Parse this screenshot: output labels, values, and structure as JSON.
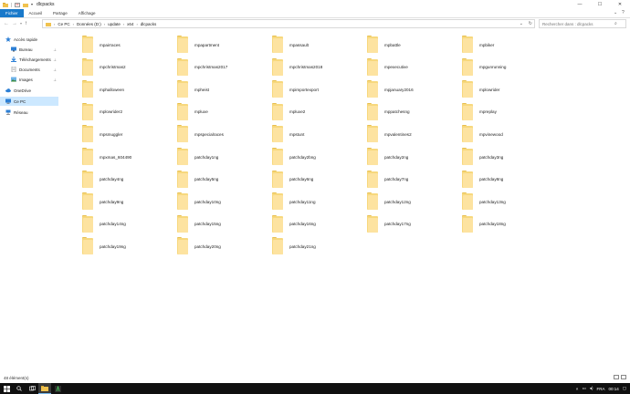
{
  "window": {
    "title": "dlcpacks",
    "minimize_glyph": "—",
    "maximize_glyph": "☐",
    "close_glyph": "✕"
  },
  "ribbon": {
    "tabs": [
      "Fichier",
      "Accueil",
      "Partage",
      "Affichage"
    ]
  },
  "address": {
    "crumbs": [
      "Ce PC",
      "Données (D:)",
      "update",
      "x64",
      "dlcpacks"
    ],
    "search_placeholder": "Rechercher dans : dlcpacks"
  },
  "sidebar": {
    "items": [
      {
        "label": "Accès rapide",
        "icon": "star-icon"
      },
      {
        "label": "Bureau",
        "icon": "desktop-icon",
        "pinned": true
      },
      {
        "label": "Téléchargements",
        "icon": "download-icon",
        "pinned": true
      },
      {
        "label": "Documents",
        "icon": "documents-icon",
        "pinned": true
      },
      {
        "label": "Images",
        "icon": "pictures-icon",
        "pinned": true
      },
      {
        "label": "OneDrive",
        "icon": "cloud-icon"
      },
      {
        "label": "Ce PC",
        "icon": "computer-icon",
        "selected": true
      },
      {
        "label": "Réseau",
        "icon": "network-icon"
      }
    ],
    "pin_glyph": "⊥"
  },
  "folders": [
    "mpairraces",
    "mpapartment",
    "mpassault",
    "mpbattle",
    "mpbiker",
    "mpchristmas2",
    "mpchristmas2017",
    "mpchristmas2018",
    "mpexecutive",
    "mpgunrunning",
    "mphalloween",
    "mpheist",
    "mpimportexport",
    "mpjanuary2016",
    "mplowrider",
    "mplowrider2",
    "mpluxe",
    "mpluxe2",
    "mppatchesng",
    "mpreplay",
    "mpsmuggler",
    "mpspecialraces",
    "mpstunt",
    "mpvalentines2",
    "mpvinewood",
    "mpxmas_604490",
    "patchday1ng",
    "patchday2bng",
    "patchday2ng",
    "patchday3ng",
    "patchday4ng",
    "patchday5ng",
    "patchday6ng",
    "patchday7ng",
    "patchday8ng",
    "patchday9ng",
    "patchday10ng",
    "patchday11ng",
    "patchday12ng",
    "patchday13ng",
    "patchday14ng",
    "patchday15ng",
    "patchday16ng",
    "patchday17ng",
    "patchday18ng",
    "patchday19ng",
    "patchday20ng",
    "patchday21ng"
  ],
  "status": {
    "count_text": "48 élément(s)"
  },
  "taskbar": {
    "language": "FRA",
    "time": "00:14"
  },
  "colors": {
    "accent": "#1979ca",
    "folder": "#f7d87d",
    "selection": "#cce8ff",
    "taskbar": "#101010"
  }
}
